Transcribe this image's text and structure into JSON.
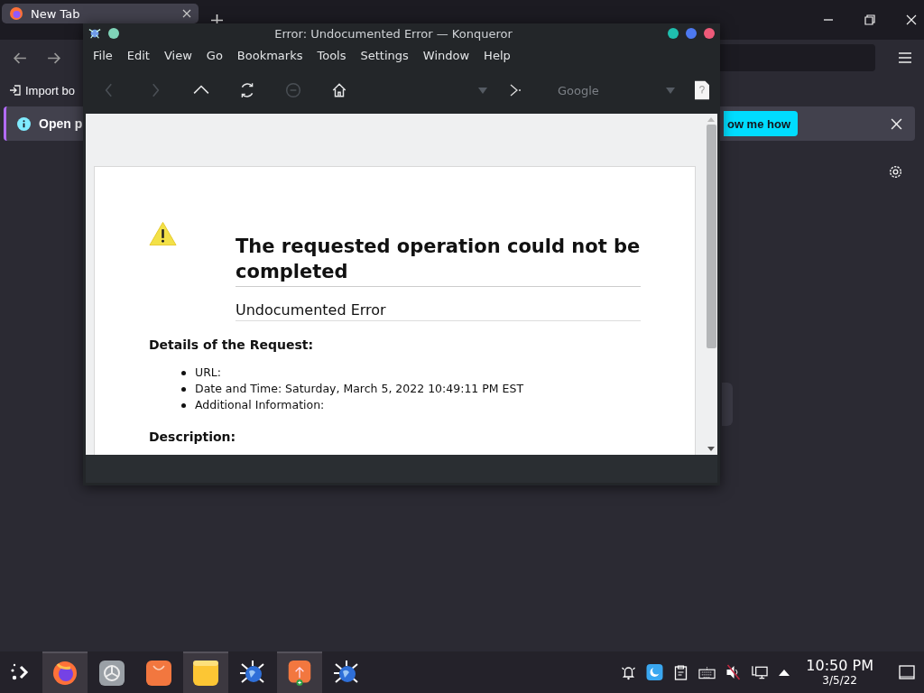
{
  "firefox": {
    "tab": {
      "title": "New Tab",
      "selected": true
    },
    "import_button": "Import bo",
    "notification": {
      "text": "Open p",
      "button": "ow me how"
    }
  },
  "konqueror": {
    "title": "Error: Undocumented Error — Konqueror",
    "menu": [
      "File",
      "Edit",
      "View",
      "Go",
      "Bookmarks",
      "Tools",
      "Settings",
      "Window",
      "Help"
    ],
    "toolbar": [
      {
        "kind": "back",
        "disabled": true
      },
      {
        "kind": "forward",
        "disabled": true
      },
      {
        "kind": "up",
        "disabled": false
      },
      {
        "kind": "reload",
        "disabled": false
      },
      {
        "kind": "stop",
        "disabled": true
      },
      {
        "kind": "home",
        "disabled": false
      }
    ],
    "search_engine": "Google",
    "page": {
      "heading": "The requested operation could not be completed",
      "subheading": "Undocumented Error",
      "details_heading": "Details of the Request:",
      "details": [
        "URL:",
        "Date and Time: Saturday, March 5, 2022 10:49:11 PM EST",
        "Additional Information:"
      ],
      "description_heading": "Description:"
    }
  },
  "taskbar": {
    "apps": [
      {
        "kind": "firefox",
        "selected": true
      },
      {
        "kind": "settings",
        "selected": false
      },
      {
        "kind": "store",
        "selected": false
      },
      {
        "kind": "files",
        "selected": true
      },
      {
        "kind": "konqueror",
        "selected": false
      },
      {
        "kind": "updater",
        "selected": true
      },
      {
        "kind": "konqueror",
        "selected": false
      }
    ],
    "clock": {
      "time": "10:50 PM",
      "date": "3/5/22"
    }
  }
}
